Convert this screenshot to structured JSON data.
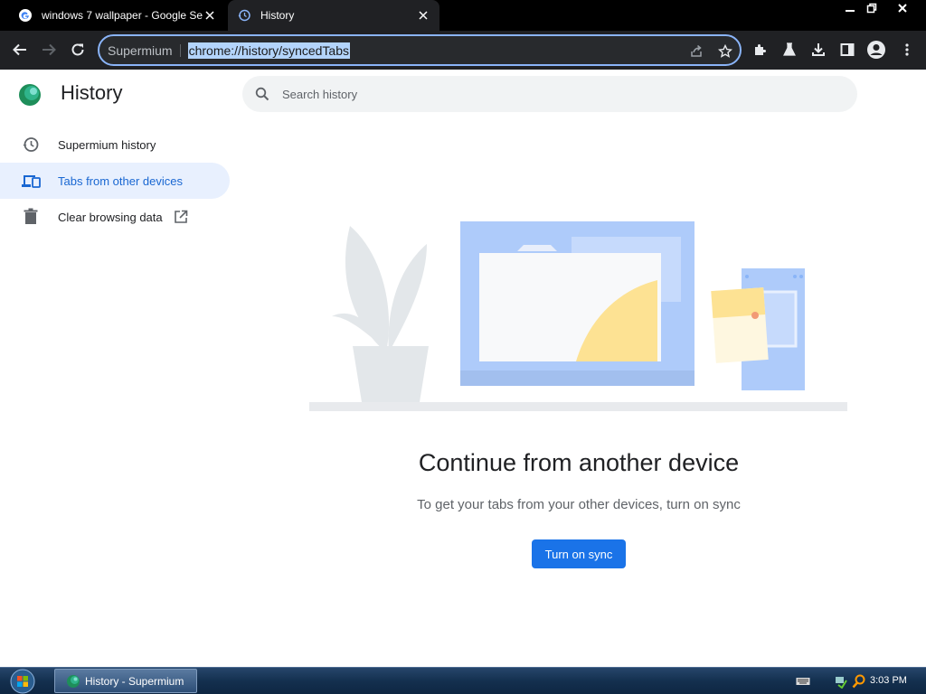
{
  "tabs": [
    {
      "title": "windows 7 wallpaper - Google Se",
      "favicon": "google-icon",
      "active": false
    },
    {
      "title": "History",
      "favicon": "history-icon",
      "active": true
    }
  ],
  "window_controls": {
    "minimize": "minimize-icon",
    "restore": "restore-icon",
    "close": "close-icon"
  },
  "toolbar": {
    "site_chip": "Supermium",
    "url": "chrome://history/syncedTabs"
  },
  "sidebar": {
    "title": "History",
    "items": [
      {
        "label": "Supermium history",
        "icon": "history-icon",
        "selected": false
      },
      {
        "label": "Tabs from other devices",
        "icon": "devices-icon",
        "selected": true
      },
      {
        "label": "Clear browsing data",
        "icon": "trash-icon",
        "selected": false
      }
    ]
  },
  "search": {
    "placeholder": "Search history"
  },
  "empty_state": {
    "heading": "Continue from another device",
    "subtext": "To get your tabs from your other devices, turn on sync",
    "button": "Turn on sync"
  },
  "taskbar": {
    "task_label": "History - Supermium",
    "clock": "3:03 PM"
  },
  "colors": {
    "accent": "#1a73e8",
    "selected_bg": "#e8f0fe",
    "omnibox_border": "#8ab4f8",
    "url_highlight": "#b3d4fb"
  }
}
